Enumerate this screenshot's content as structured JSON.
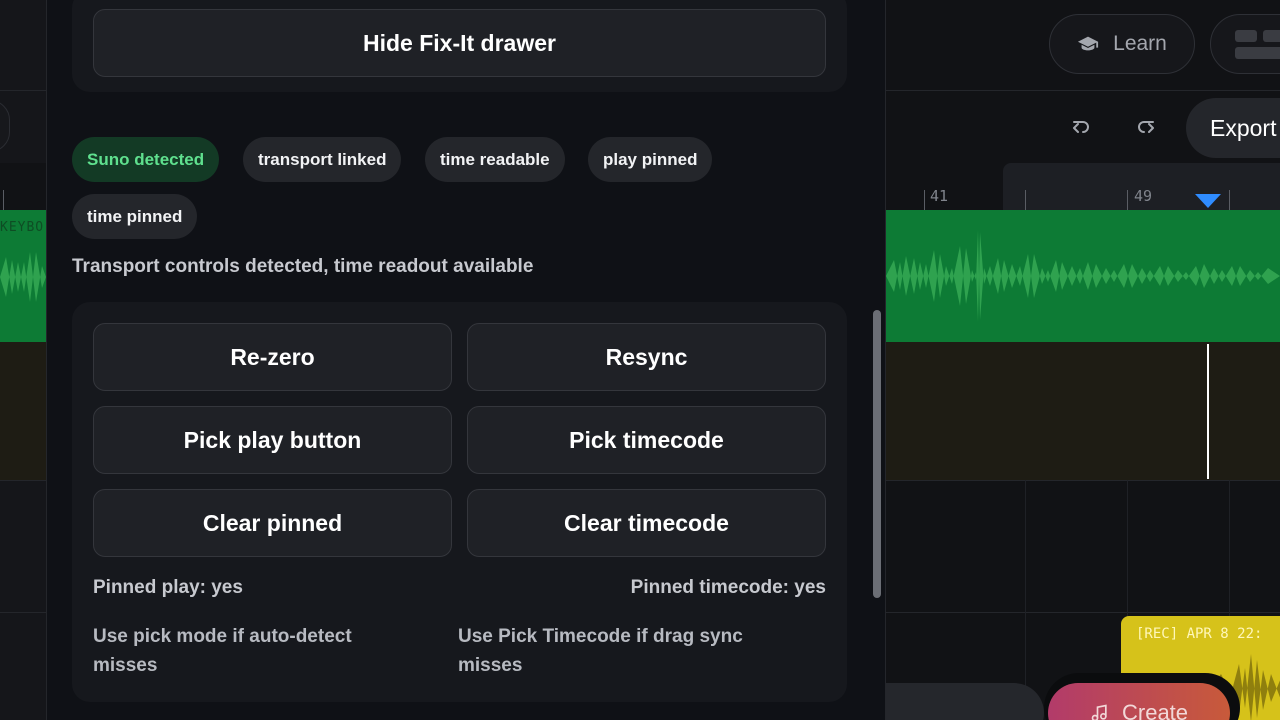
{
  "background_app": {
    "learn_label": "Learn",
    "export_label": "Export",
    "track_label": "KEYBO",
    "ruler_labels": [
      "41",
      "49"
    ],
    "rec_clip_label": "[REC] APR 8 22:",
    "create_label": "Create"
  },
  "drawer": {
    "hide_button": "Hide Fix-It drawer",
    "chips": [
      {
        "label": "Suno detected",
        "status": "ok"
      },
      {
        "label": "transport linked"
      },
      {
        "label": "time readable"
      },
      {
        "label": "play pinned"
      },
      {
        "label": "time pinned"
      }
    ],
    "status_text": "Transport controls detected, time readout available",
    "buttons": {
      "rezero": "Re-zero",
      "resync": "Resync",
      "pick_play": "Pick play button",
      "pick_timecode": "Pick timecode",
      "clear_pinned": "Clear pinned",
      "clear_timecode": "Clear timecode"
    },
    "pinned_play": "Pinned play: yes",
    "pinned_timecode": "Pinned timecode: yes",
    "hint_left": "Use pick mode if auto-detect misses",
    "hint_right": "Use Pick Timecode if drag sync misses"
  },
  "colors": {
    "ok_chip_bg": "#133a25",
    "ok_chip_text": "#5fe08e",
    "track_green": "#0d7b35",
    "playhead_blue": "#2f8cff",
    "rec_clip": "#d6c21a"
  }
}
